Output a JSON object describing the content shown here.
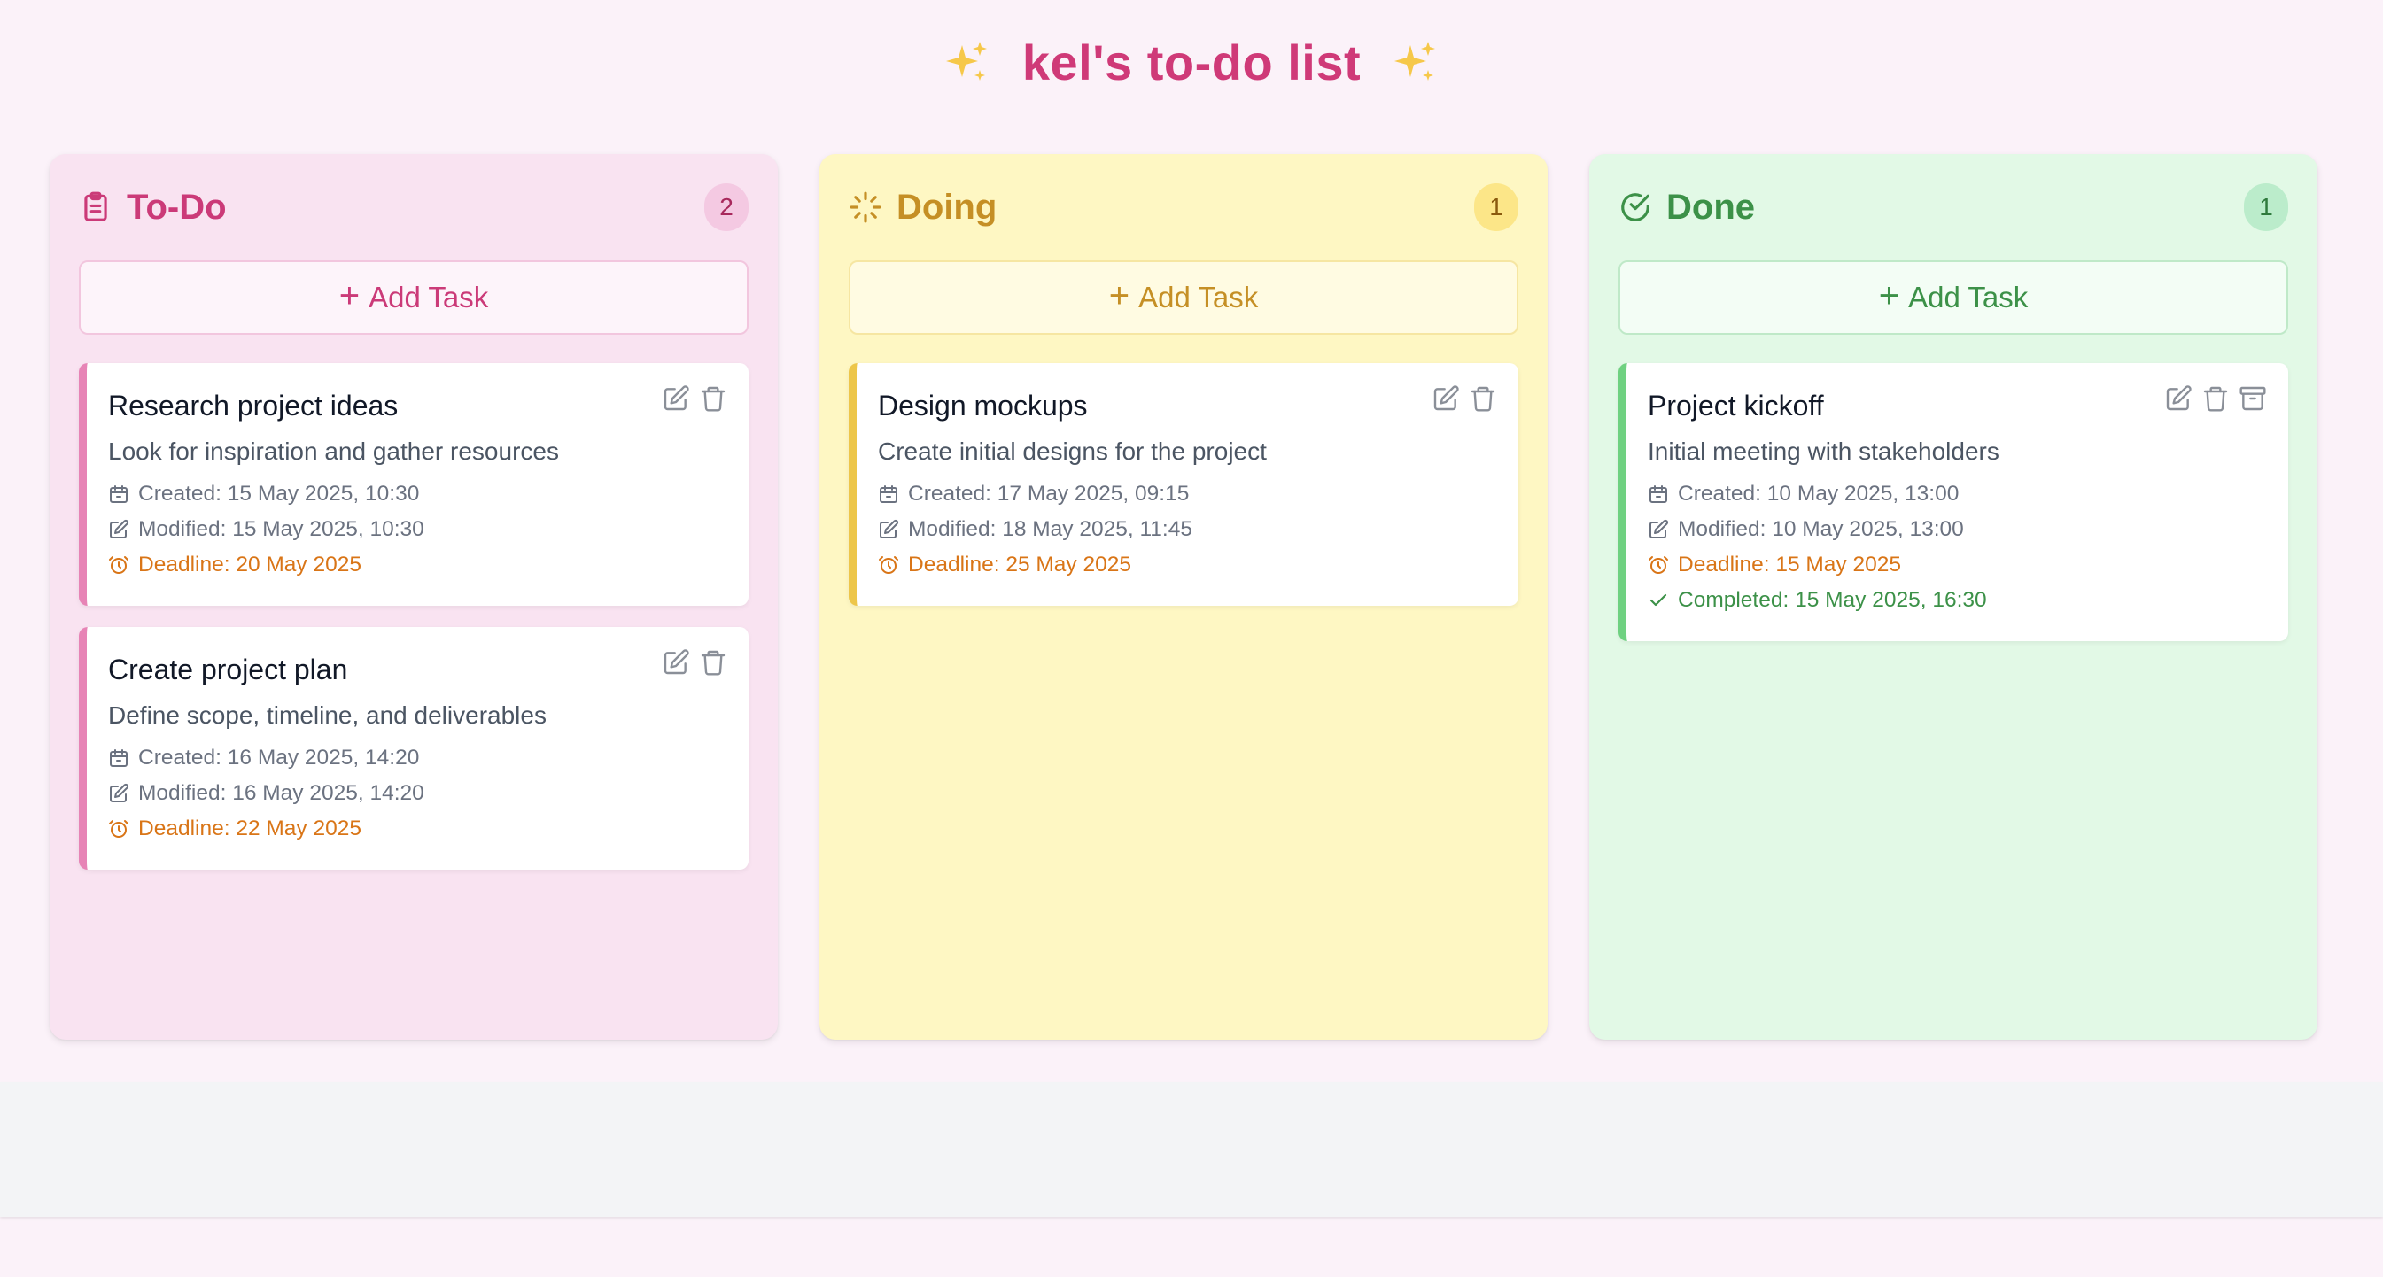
{
  "header": {
    "title": "kel's to-do list",
    "left_icon": "sparkles-icon",
    "right_icon": "sparkles-icon",
    "title_color": "#cf3a78"
  },
  "columns": [
    {
      "key": "todo",
      "title": "To-Do",
      "icon": "clipboard-icon",
      "count": "2",
      "accent": "#cb3a78",
      "add_label": "Add Task",
      "cards": [
        {
          "title": "Research project ideas",
          "description": "Look for inspiration and gather resources",
          "created": "Created: 15 May 2025, 10:30",
          "modified": "Modified: 15 May 2025, 10:30",
          "deadline": "Deadline: 20 May 2025"
        },
        {
          "title": "Create project plan",
          "description": "Define scope, timeline, and deliverables",
          "created": "Created: 16 May 2025, 14:20",
          "modified": "Modified: 16 May 2025, 14:20",
          "deadline": "Deadline: 22 May 2025"
        }
      ]
    },
    {
      "key": "doing",
      "title": "Doing",
      "icon": "loader-icon",
      "count": "1",
      "accent": "#c58f25",
      "add_label": "Add Task",
      "cards": [
        {
          "title": "Design mockups",
          "description": "Create initial designs for the project",
          "created": "Created: 17 May 2025, 09:15",
          "modified": "Modified: 18 May 2025, 11:45",
          "deadline": "Deadline: 25 May 2025"
        }
      ]
    },
    {
      "key": "done",
      "title": "Done",
      "icon": "check-circle-icon",
      "count": "1",
      "accent": "#3c9148",
      "add_label": "Add Task",
      "cards": [
        {
          "title": "Project kickoff",
          "description": "Initial meeting with stakeholders",
          "created": "Created: 10 May 2025, 13:00",
          "modified": "Modified: 10 May 2025, 13:00",
          "deadline": "Deadline: 15 May 2025",
          "completed": "Completed: 15 May 2025, 16:30"
        }
      ]
    }
  ]
}
